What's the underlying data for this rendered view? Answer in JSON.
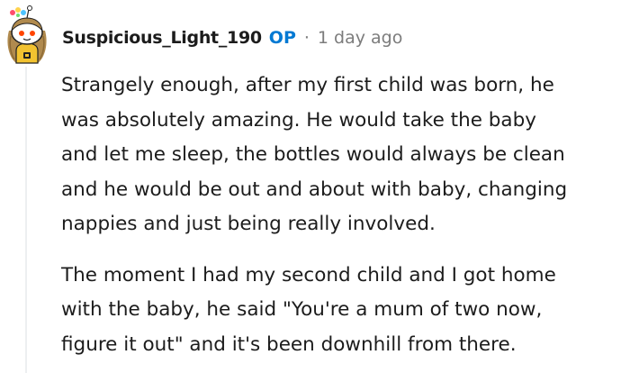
{
  "comment": {
    "author": "Suspicious_Light_190",
    "op_badge": "OP",
    "separator": "·",
    "timestamp": "1 day ago",
    "avatar_icon": "snoo-avatar-icon",
    "paragraphs": [
      {
        "lines": [
          "Strangely enough, after my first child was born, he",
          "was absolutely amazing. He would take the baby",
          "and let me sleep, the bottles would always be clean",
          "and he would be out and about with baby, changing",
          "nappies and just being really involved."
        ]
      },
      {
        "lines": [
          "The moment I had my second child and I got home",
          "with the baby, he said \"You're a mum of two now,",
          "figure it out\" and it's been downhill from there."
        ]
      }
    ]
  },
  "colors": {
    "text": "#1c1c1c",
    "op_badge": "#0079d3",
    "meta_gray": "#7c7c7c",
    "thread_line": "#edeff1"
  }
}
